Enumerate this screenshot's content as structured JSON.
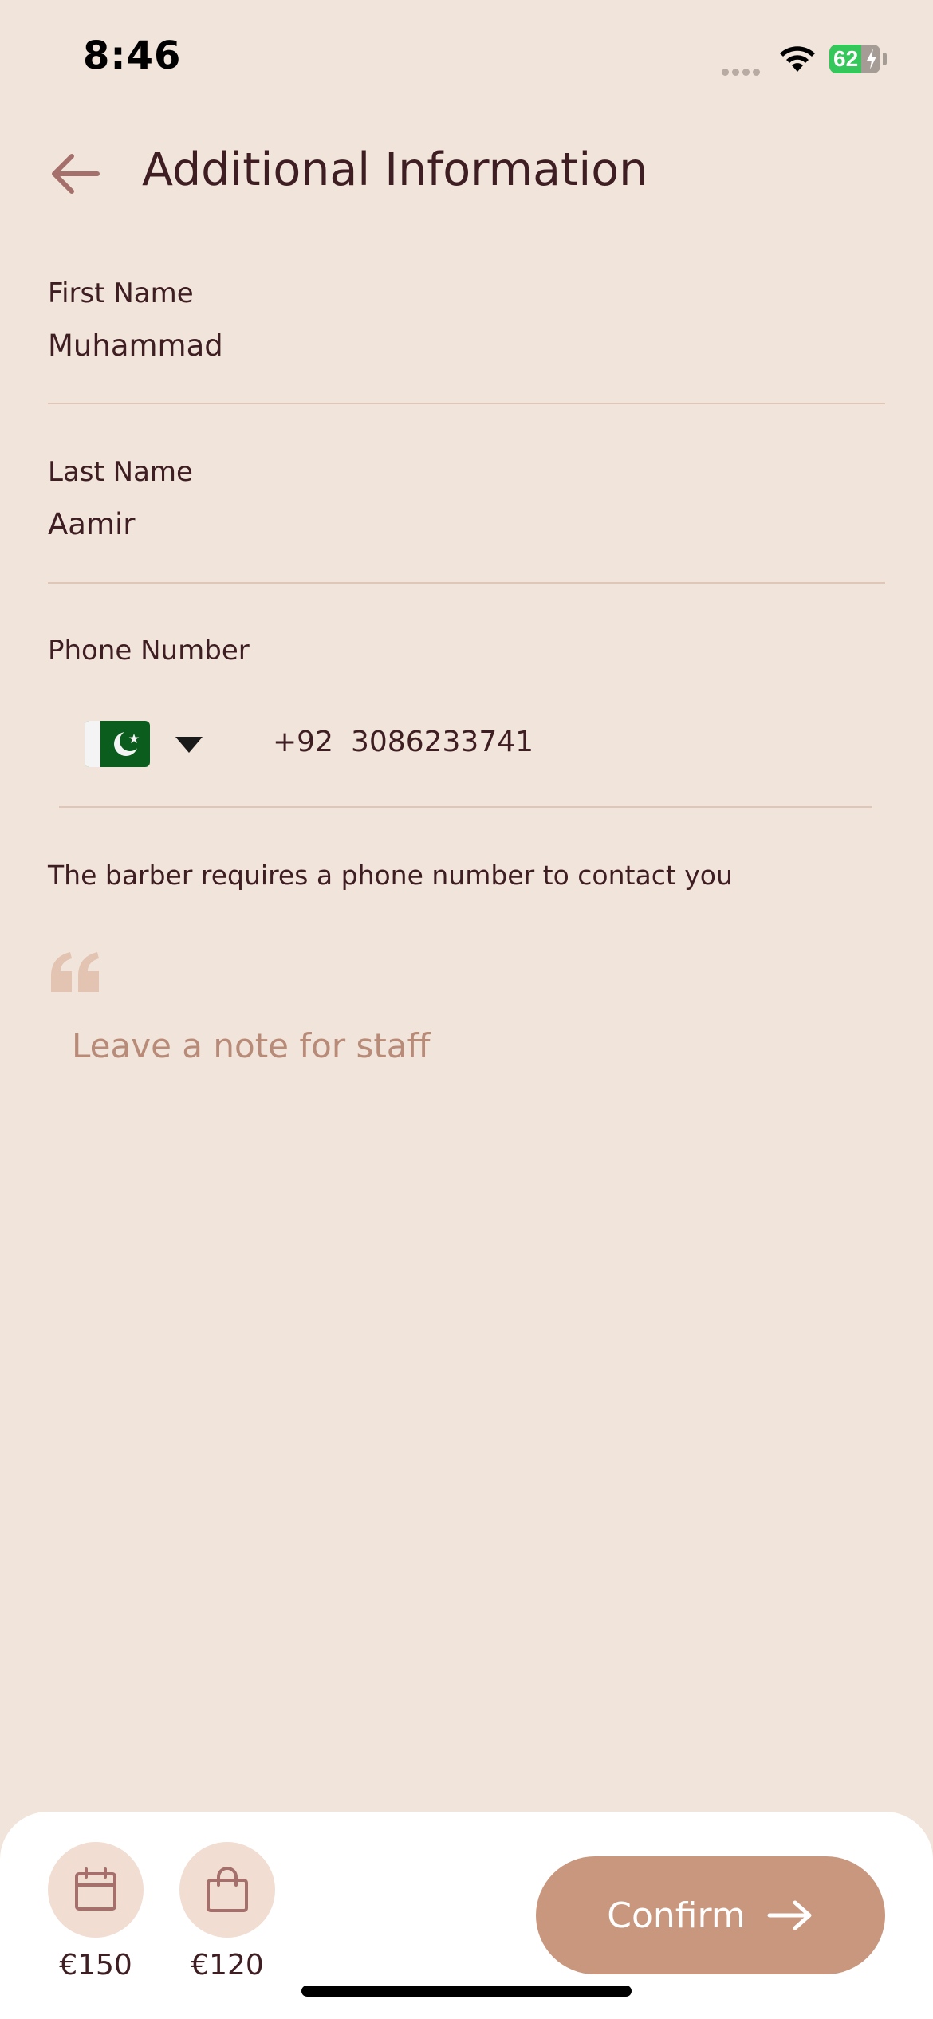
{
  "status_bar": {
    "time": "8:46",
    "battery_level": "62",
    "battery_fraction": 0.62
  },
  "header": {
    "title": "Additional Information",
    "back_icon": "arrow-left-icon"
  },
  "form": {
    "first_name": {
      "label": "First Name",
      "value": "Muhammad"
    },
    "last_name": {
      "label": "Last Name",
      "value": "Aamir"
    },
    "phone": {
      "label": "Phone Number",
      "country_flag": "pakistan-flag-icon",
      "dial_code": "+92",
      "number": "3086233741"
    },
    "helper_text": "The barber requires a phone number to contact you",
    "note": {
      "placeholder": "Leave a note for staff",
      "icon": "quote-icon"
    }
  },
  "bottom_bar": {
    "items": [
      {
        "icon": "calendar-icon",
        "price": "€150"
      },
      {
        "icon": "shopping-bag-icon",
        "price": "€120"
      }
    ],
    "confirm_label": "Confirm",
    "confirm_icon": "arrow-right-icon"
  },
  "colors": {
    "background": "#F1E4DA",
    "text": "#3E1E22",
    "accent": "#C9967E",
    "icon_brown": "#A5706B",
    "placeholder": "#B88A78"
  }
}
